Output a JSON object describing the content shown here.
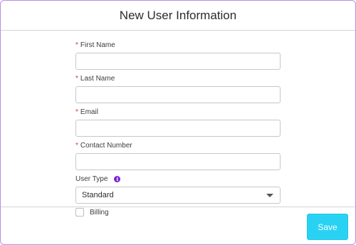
{
  "dialog": {
    "title": "New User Information"
  },
  "form": {
    "required_mark": "*",
    "first_name": {
      "label": "First Name",
      "value": ""
    },
    "last_name": {
      "label": "Last Name",
      "value": ""
    },
    "email": {
      "label": "Email",
      "value": ""
    },
    "contact_number": {
      "label": "Contact Number",
      "value": ""
    },
    "user_type": {
      "label": "User Type",
      "info_glyph": "i",
      "selected": "Standard"
    },
    "billing": {
      "label": "Billing",
      "checked": false
    }
  },
  "footer": {
    "save_label": "Save"
  },
  "colors": {
    "accent_purple": "#7a22d6",
    "modal_border": "#b98ee0",
    "save_button": "#29d2f3",
    "required": "#d9302c"
  },
  "icons": {
    "info": "info-icon",
    "dropdown": "chevron-down-icon",
    "checkbox": "checkbox-icon"
  }
}
